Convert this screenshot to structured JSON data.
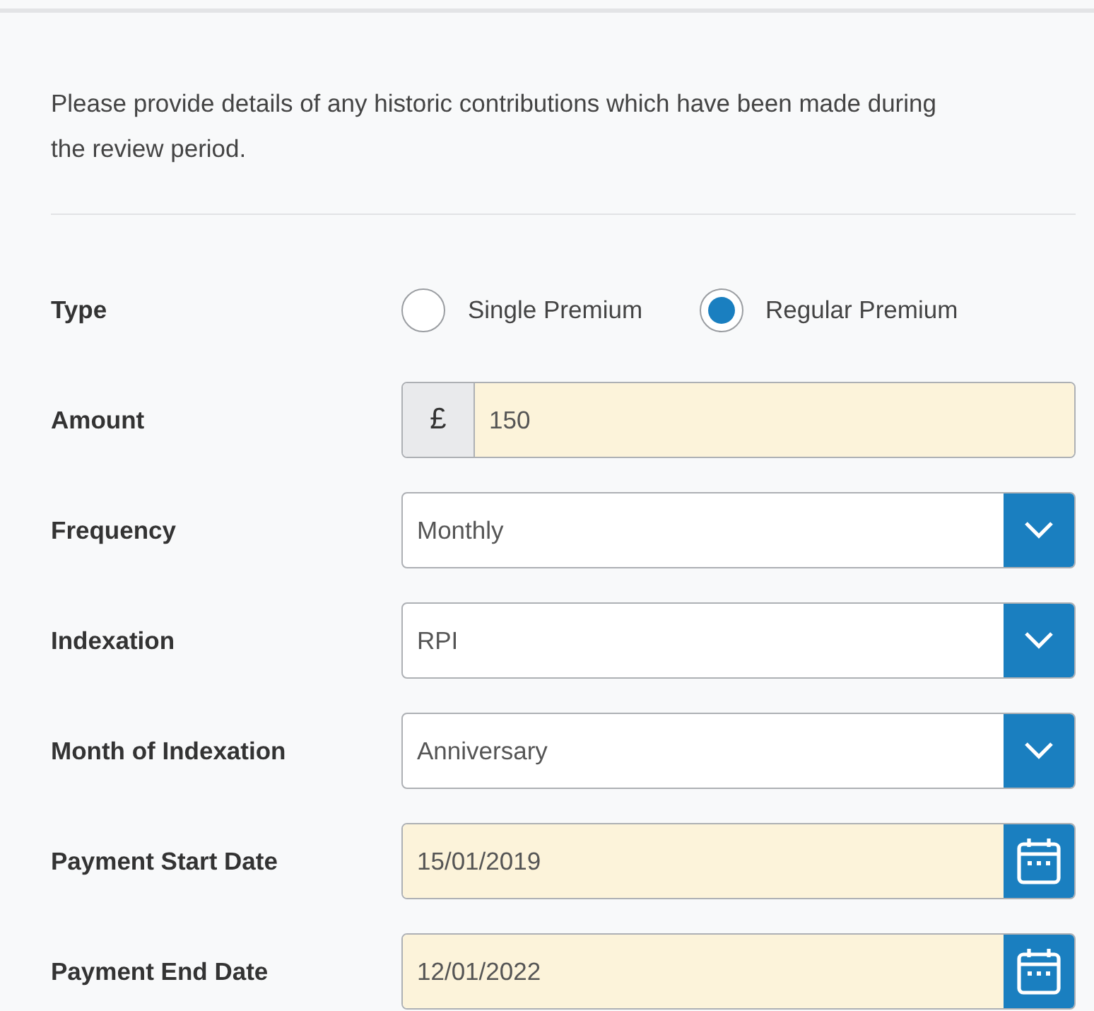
{
  "intro": "Please provide details of any historic contributions which have been made during the review period.",
  "fields": [
    {
      "kind": "radio",
      "label": "Type",
      "options": [
        {
          "label": "Single Premium",
          "selected": false
        },
        {
          "label": "Regular Premium",
          "selected": true
        }
      ]
    },
    {
      "kind": "prefixed",
      "label": "Amount",
      "prefix": "£",
      "value": "150",
      "highlighted": true
    },
    {
      "kind": "select",
      "label": "Frequency",
      "value": "Monthly",
      "highlighted": false
    },
    {
      "kind": "select",
      "label": "Indexation",
      "value": "RPI",
      "highlighted": false
    },
    {
      "kind": "select",
      "label": "Month of Indexation",
      "value": "Anniversary",
      "highlighted": false
    },
    {
      "kind": "date",
      "label": "Payment Start Date",
      "value": "15/01/2019",
      "highlighted": true
    },
    {
      "kind": "date",
      "label": "Payment End Date",
      "value": "12/01/2022",
      "highlighted": true
    }
  ]
}
